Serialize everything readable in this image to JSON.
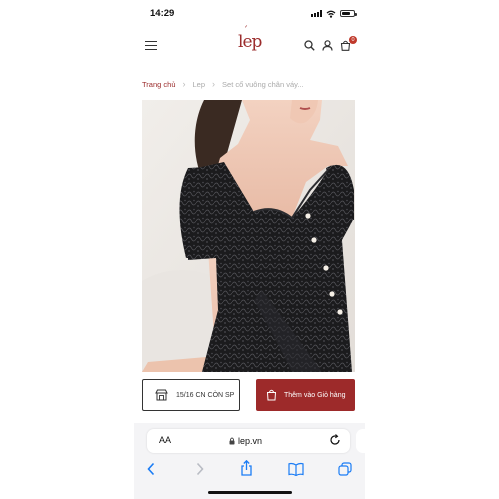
{
  "status_bar": {
    "time": "14:29"
  },
  "header": {
    "cart_count": "0",
    "logo_text": "lép"
  },
  "breadcrumb": {
    "home": "Trang chủ",
    "category": "Lep",
    "current": "Set cổ vuông chân váy..."
  },
  "product": {
    "stock_label": "15/16 CN CÒN SP",
    "add_to_cart_label": "Thêm vào Giỏ hàng"
  },
  "safari": {
    "text_size_label": "AA",
    "url": "lep.vn"
  },
  "colors": {
    "brand": "#9b2c2c",
    "cart_button": "#9d2a2a",
    "ios_blue": "#1a7cf5"
  },
  "icons": [
    "wifi-icon",
    "battery-icon",
    "menu-icon",
    "search-icon",
    "user-icon",
    "cart-icon",
    "store-icon",
    "shopping-bag-icon",
    "lock-icon",
    "reload-icon",
    "back-icon",
    "forward-icon",
    "share-icon",
    "bookmarks-icon",
    "tabs-icon"
  ]
}
